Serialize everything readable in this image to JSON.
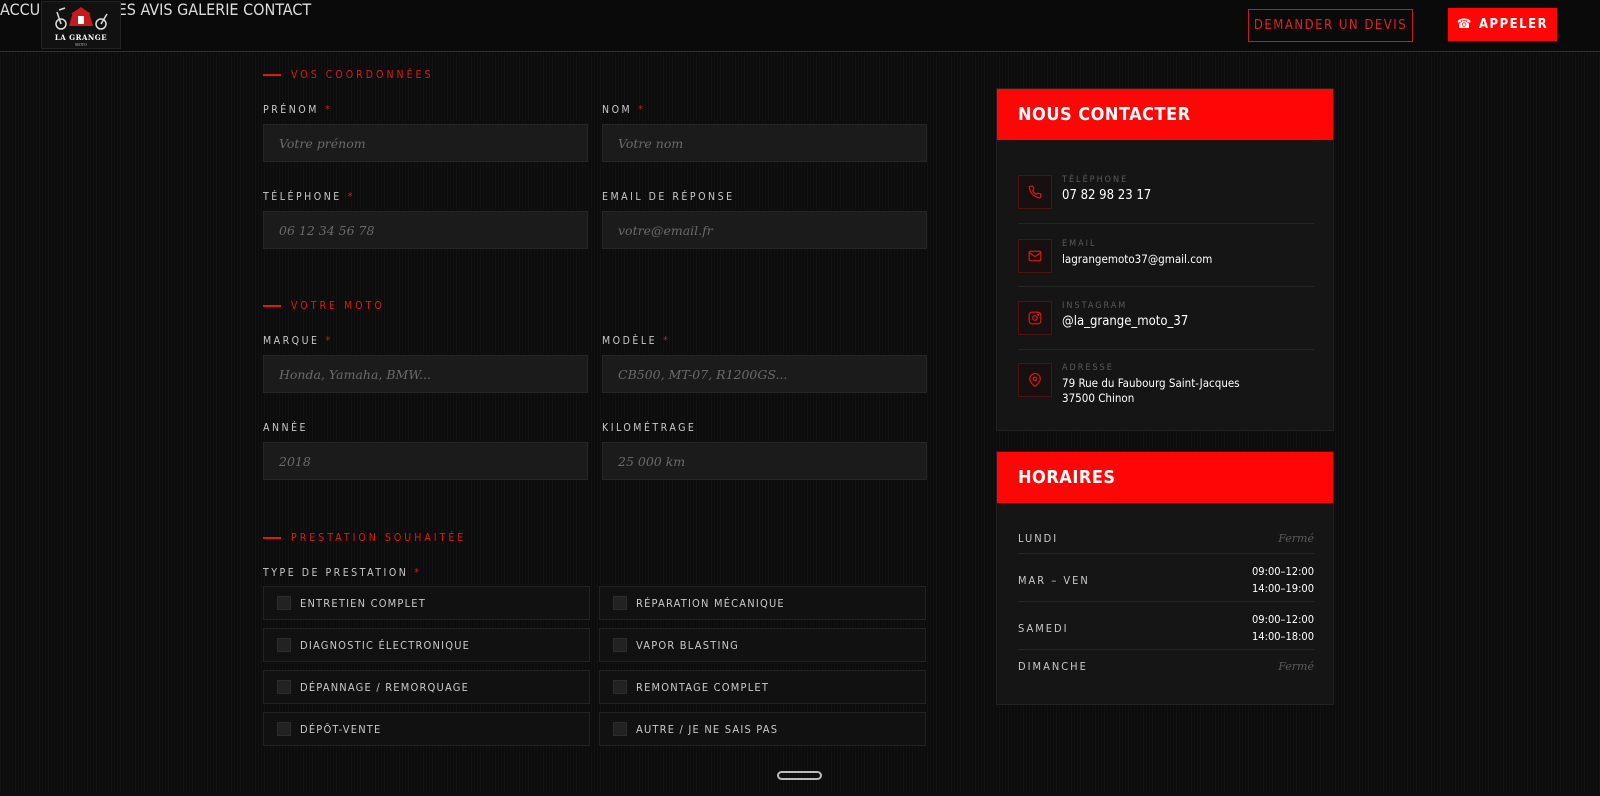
{
  "header": {
    "logo": {
      "text": "LA GRANGE",
      "sub": "MOTO"
    },
    "nav": [
      "ACCUEIL",
      "SERVICES",
      "AVIS",
      "GALERIE",
      "CONTACT"
    ],
    "devis_label": "DEMANDER UN DEVIS",
    "appeler_label": "APPELER",
    "appeler_icon": "phone-icon"
  },
  "form": {
    "sections": {
      "coordonnees": "VOS COORDONNÉES",
      "moto": "VOTRE MOTO",
      "prestation": "PRESTATION SOUHAITÉE"
    },
    "fields": {
      "prenom": {
        "label": "PRÉNOM",
        "required": "*",
        "placeholder": "Votre prénom"
      },
      "nom": {
        "label": "NOM",
        "required": "*",
        "placeholder": "Votre nom"
      },
      "telephone": {
        "label": "TÉLÉPHONE",
        "required": "*",
        "placeholder": "06 12 34 56 78"
      },
      "email": {
        "label": "EMAIL DE RÉPONSE",
        "placeholder": "votre@email.fr"
      },
      "marque": {
        "label": "MARQUE",
        "required": "*",
        "placeholder": "Honda, Yamaha, BMW..."
      },
      "modele": {
        "label": "MODÈLE",
        "required": "*",
        "placeholder": "CB500, MT-07, R1200GS..."
      },
      "annee": {
        "label": "ANNÉE",
        "placeholder": "2018"
      },
      "kilometrage": {
        "label": "KILOMÉTRAGE",
        "placeholder": "25 000 km"
      }
    },
    "prestation_type": {
      "label": "TYPE DE PRESTATION",
      "required": "*"
    },
    "options": [
      "ENTRETIEN COMPLET",
      "RÉPARATION MÉCANIQUE",
      "DIAGNOSTIC ÉLECTRONIQUE",
      "VAPOR BLASTING",
      "DÉPANNAGE / REMORQUAGE",
      "REMONTAGE COMPLET",
      "DÉPÔT-VENTE",
      "AUTRE / JE NE SAIS PAS"
    ]
  },
  "contact": {
    "title": "NOUS CONTACTER",
    "telephone": {
      "label": "TÉLÉPHONE",
      "value": "07 82 98 23 17"
    },
    "email": {
      "label": "EMAIL",
      "value": "lagrangemoto37@gmail.com"
    },
    "instagram": {
      "label": "INSTAGRAM",
      "value": "@la_grange_moto_37"
    },
    "adresse": {
      "label": "ADRESSE",
      "line1": "79 Rue du Faubourg Saint-Jacques",
      "line2": "37500 Chinon"
    }
  },
  "horaires": {
    "title": "HORAIRES",
    "rows": [
      {
        "day": "LUNDI",
        "value": "Fermé"
      },
      {
        "day": "MAR – VEN",
        "line1": "09:00–12:00",
        "line2": "14:00–19:00"
      },
      {
        "day": "SAMEDI",
        "line1": "09:00–12:00",
        "line2": "14:00–18:00"
      },
      {
        "day": "DIMANCHE",
        "value": "Fermé"
      }
    ]
  },
  "colors": {
    "accent": "#ff0606",
    "background": "#0c0c0c",
    "field": "#1b1b1b"
  }
}
